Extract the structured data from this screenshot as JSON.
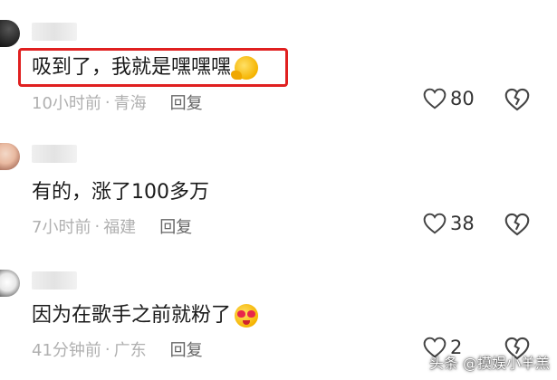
{
  "comments": [
    {
      "text": "吸到了，我就是嘿嘿嘿",
      "emoji": "thinking-face-emoji",
      "time": "10小时前",
      "separator": "·",
      "location": "青海",
      "reply_label": "回复",
      "likes": "80",
      "highlighted": true
    },
    {
      "text": "有的，涨了100多万",
      "time": "7小时前",
      "separator": "·",
      "location": "福建",
      "reply_label": "回复",
      "likes": "38"
    },
    {
      "text": "因为在歌手之前就粉了",
      "emoji": "heart-eyes-emoji",
      "time": "41分钟前",
      "separator": "·",
      "location": "广东",
      "reply_label": "回复",
      "likes": "2"
    }
  ],
  "watermark": "头条 @摸娱小羊羔",
  "colors": {
    "highlight_border": "#e02020",
    "meta_text": "#b0b0b0",
    "reply_text": "#666666"
  }
}
